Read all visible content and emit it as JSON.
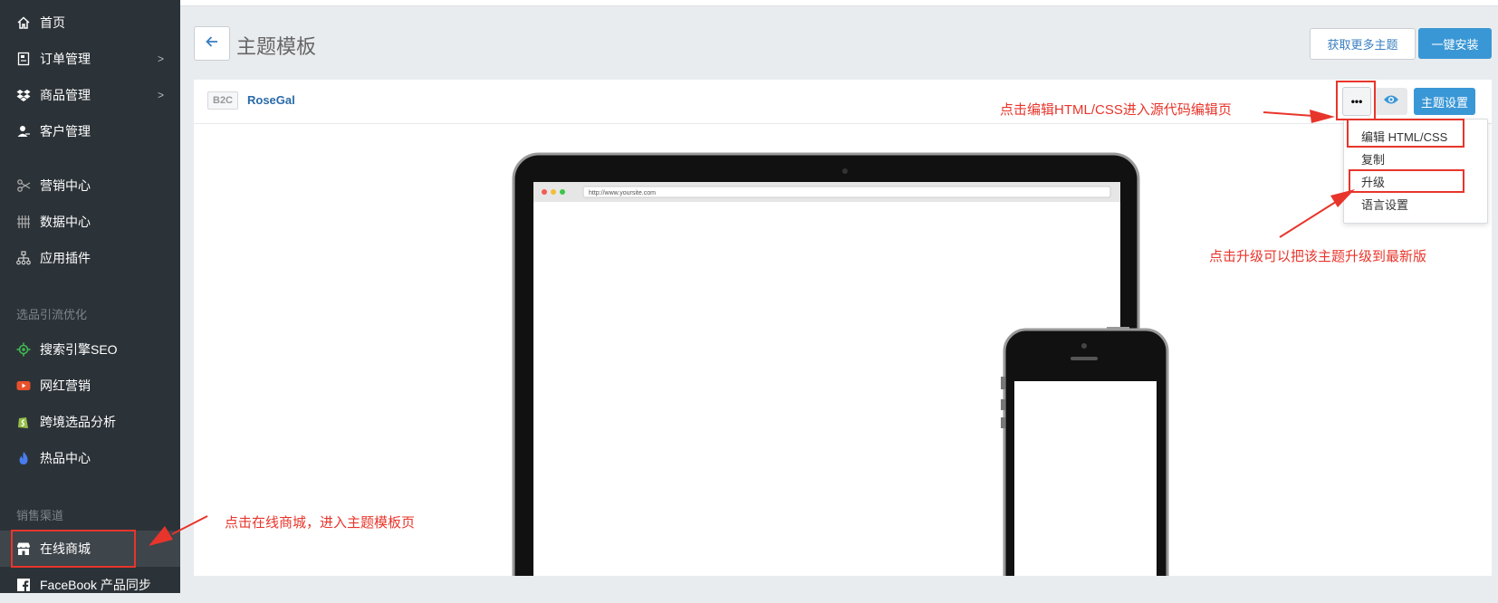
{
  "sidebar": {
    "items": [
      {
        "label": "首页",
        "icon": "home-icon"
      },
      {
        "label": "订单管理",
        "icon": "order-icon",
        "chevron": ">"
      },
      {
        "label": "商品管理",
        "icon": "dropbox-icon",
        "chevron": ">"
      },
      {
        "label": "客户管理",
        "icon": "user-icon"
      },
      {
        "label": "营销中心",
        "icon": "scissors-icon"
      },
      {
        "label": "数据中心",
        "icon": "grid-icon"
      },
      {
        "label": "应用插件",
        "icon": "sitemap-icon"
      }
    ],
    "section_seo": "选品引流优化",
    "seo_items": [
      {
        "label": "搜索引擎SEO",
        "icon": "seo-icon"
      },
      {
        "label": "网红营销",
        "icon": "youtube-icon"
      },
      {
        "label": "跨境选品分析",
        "icon": "shopify-icon"
      },
      {
        "label": "热品中心",
        "icon": "flame-icon"
      }
    ],
    "section_sales": "销售渠道",
    "sales_items": [
      {
        "label": "在线商城",
        "icon": "store-icon"
      },
      {
        "label": "FaceBook 产品同步",
        "icon": "facebook-icon"
      }
    ]
  },
  "header": {
    "title": "主题模板",
    "more_themes": "获取更多主题",
    "install": "一键安装"
  },
  "theme": {
    "badge": "B2C",
    "name": "RoseGal",
    "more_label": "•••",
    "settings_label": "主题设置",
    "preview_url": "http://www.yoursite.com"
  },
  "dropdown": {
    "items": [
      "编辑 HTML/CSS",
      "复制",
      "升级",
      "语言设置"
    ]
  },
  "annotations": {
    "edit_html": "点击编辑HTML/CSS进入源代码编辑页",
    "upgrade": "点击升级可以把该主题升级到最新版",
    "online_store": "点击在线商城，进入主题模板页"
  },
  "colors": {
    "sidebar_bg": "#2c3338",
    "primary": "#3a97d6",
    "annotation_red": "#e8352b"
  }
}
